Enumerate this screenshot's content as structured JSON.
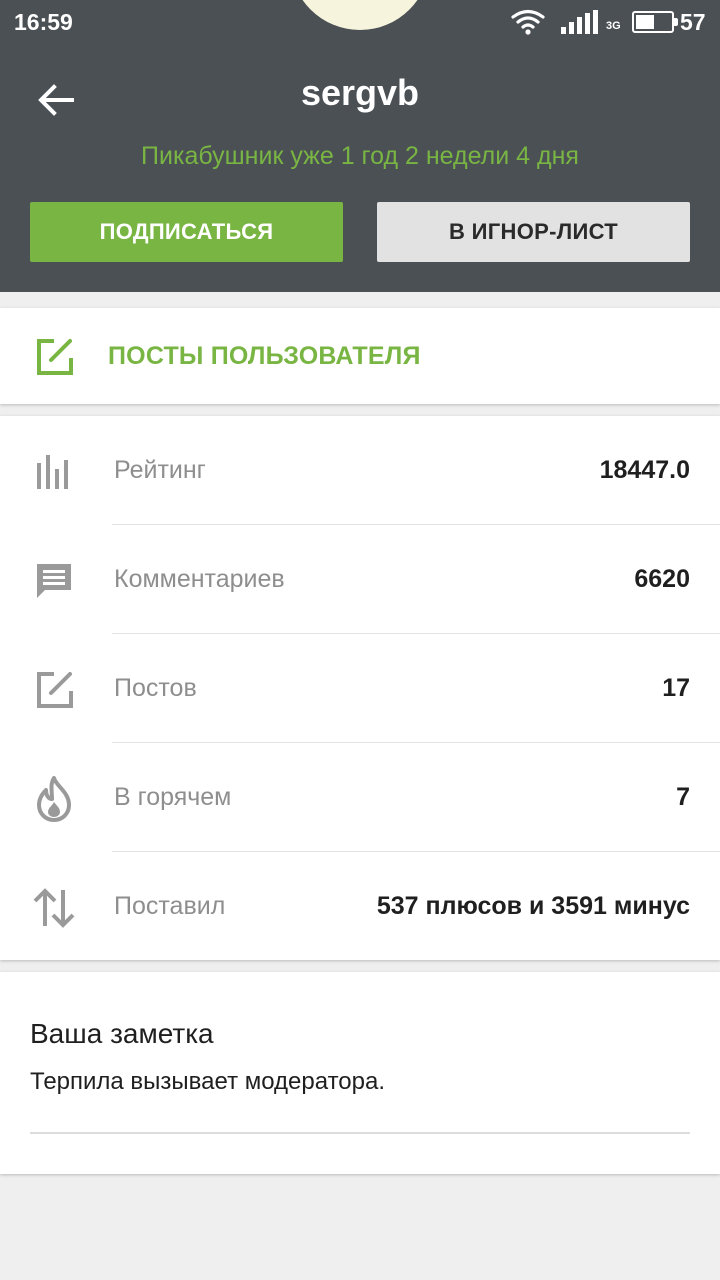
{
  "status_bar": {
    "time": "16:59",
    "network": "3G",
    "battery": "57",
    "battery_fraction": 0.57
  },
  "profile": {
    "username": "sergvb",
    "tenure": "Пикабушник уже 1 год 2 недели 4 дня",
    "subscribe_label": "ПОДПИСАТЬСЯ",
    "ignore_label": "В ИГНОР-ЛИСТ"
  },
  "posts_link": {
    "label": "ПОСТЫ ПОЛЬЗОВАТЕЛЯ",
    "icon": "edit-icon"
  },
  "stats": [
    {
      "icon": "bar-chart-icon",
      "label": "Рейтинг",
      "value": "18447.0"
    },
    {
      "icon": "comment-icon",
      "label": "Комментариев",
      "value": "6620"
    },
    {
      "icon": "edit-icon",
      "label": "Постов",
      "value": "17"
    },
    {
      "icon": "flame-icon",
      "label": "В горячем",
      "value": "7"
    },
    {
      "icon": "up-down-arrows-icon",
      "label": "Поставил",
      "value": "537 плюсов и 3591 минус"
    }
  ],
  "note": {
    "title": "Ваша заметка",
    "text": "Терпила вызывает модератора."
  },
  "colors": {
    "accent": "#79b543",
    "header_bg": "#4b5055",
    "icon_gray": "#9a9a9a"
  }
}
